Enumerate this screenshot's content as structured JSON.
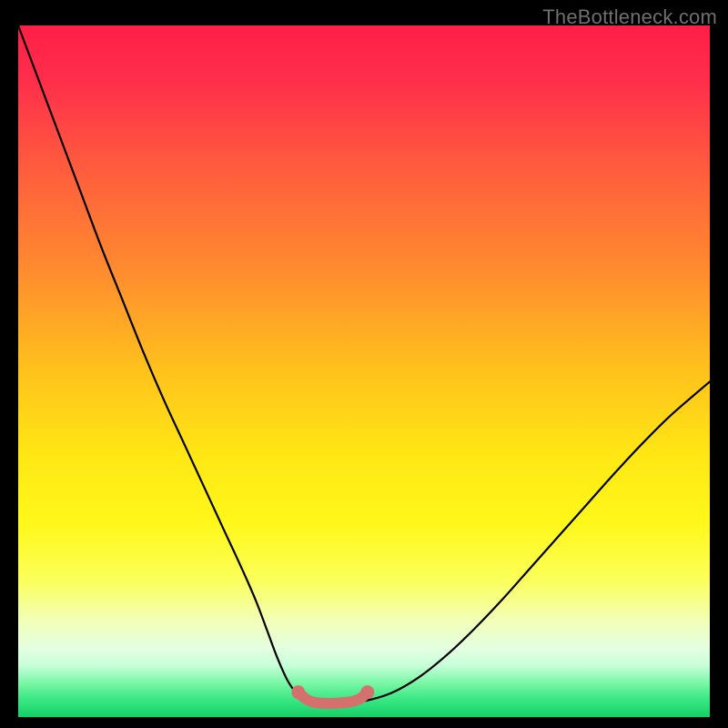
{
  "watermark": "TheBottleneck.com",
  "chart_data": {
    "type": "line",
    "title": "",
    "xlabel": "",
    "ylabel": "",
    "xlim": [
      0,
      100
    ],
    "ylim": [
      0,
      100
    ],
    "series": [
      {
        "name": "bottleneck-curve",
        "x": [
          0,
          3,
          6,
          9,
          12,
          15,
          18,
          21,
          24,
          27,
          30,
          31.5,
          33,
          34.5,
          36,
          37.5,
          39,
          40.5,
          42,
          44,
          47,
          50,
          54,
          58,
          62,
          66,
          70,
          74,
          78,
          82,
          86,
          90,
          94,
          98,
          100
        ],
        "y": [
          100,
          92,
          84,
          76,
          68,
          60.5,
          53,
          46,
          39.5,
          33,
          26.5,
          23.3,
          20,
          16.5,
          12.5,
          8.5,
          5.2,
          3.2,
          2.3,
          2.0,
          2.0,
          2.3,
          3.5,
          5.8,
          9.0,
          12.8,
          17.0,
          21.5,
          26.0,
          30.5,
          35.0,
          39.3,
          43.3,
          46.8,
          48.5
        ]
      },
      {
        "name": "valley-marker",
        "x": [
          40.5,
          41.5,
          42.5,
          44,
          46,
          48,
          49.5,
          50.5
        ],
        "y": [
          3.6,
          2.7,
          2.2,
          2.0,
          2.0,
          2.2,
          2.7,
          3.6
        ]
      }
    ],
    "gradient_stops": [
      {
        "offset": 0.0,
        "color": "#ff1f47"
      },
      {
        "offset": 0.08,
        "color": "#ff2e4b"
      },
      {
        "offset": 0.2,
        "color": "#ff5a3e"
      },
      {
        "offset": 0.35,
        "color": "#ff8a2f"
      },
      {
        "offset": 0.5,
        "color": "#ffc21c"
      },
      {
        "offset": 0.62,
        "color": "#ffe714"
      },
      {
        "offset": 0.72,
        "color": "#fff81a"
      },
      {
        "offset": 0.8,
        "color": "#fbff58"
      },
      {
        "offset": 0.86,
        "color": "#f2ffb6"
      },
      {
        "offset": 0.9,
        "color": "#e4ffe0"
      },
      {
        "offset": 0.925,
        "color": "#c8ffda"
      },
      {
        "offset": 0.95,
        "color": "#7cf7a6"
      },
      {
        "offset": 0.975,
        "color": "#38e783"
      },
      {
        "offset": 1.0,
        "color": "#15cf66"
      }
    ],
    "curve_color": "#000000",
    "marker_color": "#d4706e"
  }
}
